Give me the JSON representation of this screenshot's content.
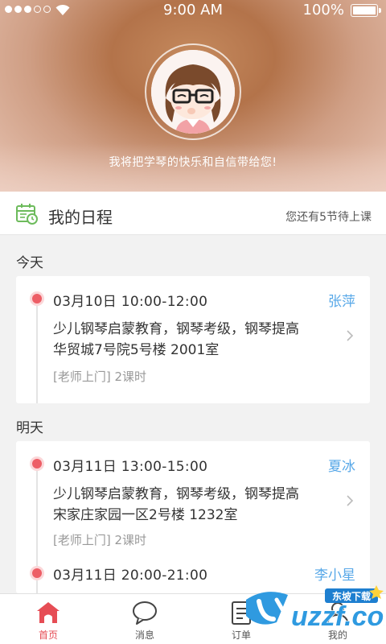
{
  "status_bar": {
    "time": "9:00 AM",
    "battery": "100%"
  },
  "header": {
    "tagline": "我将把学琴的快乐和自信带给您!"
  },
  "schedule": {
    "title": "我的日程",
    "note": "您还有5节待上课"
  },
  "days": [
    {
      "label": "今天",
      "lessons": [
        {
          "time": "03月10日   10:00-12:00",
          "teacher": "张萍",
          "course": "少儿钢琴启蒙教育，钢琴考级，钢琴提高",
          "address": "华贸城7号院5号楼  2001室",
          "meta": "[老师上门]  2课时"
        }
      ]
    },
    {
      "label": "明天",
      "lessons": [
        {
          "time": "03月11日   13:00-15:00",
          "teacher": "夏冰",
          "course": "少儿钢琴启蒙教育，钢琴考级，钢琴提高",
          "address": "宋家庄家园一区2号楼  1232室",
          "meta": "[老师上门]  2课时"
        },
        {
          "time": "03月11日   20:00-21:00",
          "teacher": "李小星"
        }
      ]
    }
  ],
  "tabs": [
    {
      "label": "首页",
      "icon": "home-icon",
      "active": true
    },
    {
      "label": "消息",
      "icon": "message-icon",
      "active": false
    },
    {
      "label": "订单",
      "icon": "order-icon",
      "active": false
    },
    {
      "label": "我的",
      "icon": "profile-icon",
      "active": false
    }
  ],
  "watermark": {
    "brand": "uzzf.com",
    "sub": "东坡下载"
  },
  "colors": {
    "accent": "#e64d55",
    "teacher": "#58a8e8",
    "calendar_icon": "#6dbb5c",
    "dot": "#ed5e66"
  }
}
